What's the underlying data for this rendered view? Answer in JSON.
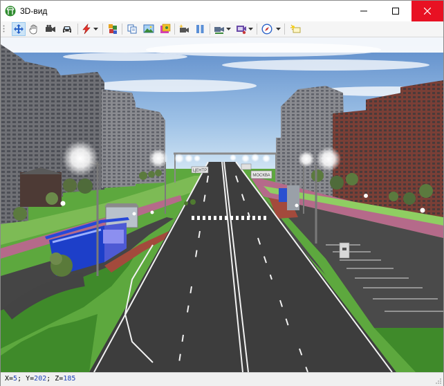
{
  "window": {
    "title": "3D-вид"
  },
  "icons": {
    "app": "street-lamp-icon",
    "minimize": "minimize-icon",
    "maximize": "maximize-icon",
    "close": "close-icon"
  },
  "toolbar": {
    "buttons": [
      "move-arrows-icon",
      "hand-pan-icon",
      "video-camera-icon",
      "car-icon",
      "lightning-icon",
      "paint-palette-icon",
      "copy-pages-icon",
      "image-icon",
      "colored-image-icon",
      "record-camera-icon",
      "pause-icon",
      "camera-motion-icon",
      "camera-settings-icon",
      "compass-icon",
      "light-bulb-icon"
    ],
    "active": "move-arrows-icon"
  },
  "status": {
    "x_label": "X=",
    "x": "5",
    "sep1": "; ",
    "y_label": "Y=",
    "y": "202",
    "sep2": "; ",
    "z_label": "Z=",
    "z": "185"
  },
  "scene": {
    "description_colors": {
      "sky": "#6f9fd4",
      "grass": "#4f9a34",
      "asphalt": "#3d3d3d",
      "sidewalk": "#a34a3c",
      "kiosk": "#1d3fc9"
    },
    "signs": [
      "ЦЕНТР",
      "МОСКВА"
    ]
  }
}
